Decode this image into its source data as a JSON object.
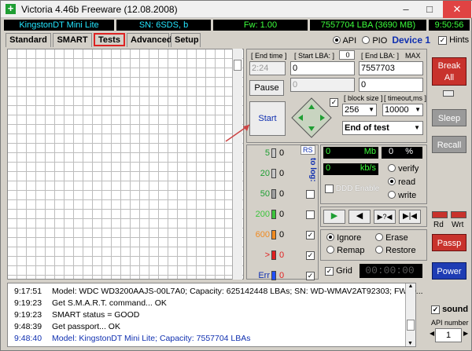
{
  "window": {
    "title": "Victoria 4.46b Freeware (12.08.2008)"
  },
  "status": {
    "drive": "KingstonDT Mini Lite",
    "sn": "SN: 6SDS",
    "sn_suffix": ", b",
    "fw": "Fw: 1.00",
    "lba": "7557704 LBA (3690 MB)",
    "time": "9:50:56"
  },
  "tabs": [
    "Standard",
    "SMART",
    "Tests",
    "Advanced",
    "Setup"
  ],
  "mode": {
    "api": "API",
    "pio": "PIO",
    "device": "Device 1",
    "hints": "Hints"
  },
  "tests": {
    "end_time_label": "[ End time ]",
    "end_time": "2:24",
    "start_lba_label": "[ Start LBA: ]",
    "start_lba_counter": "0",
    "start_lba": "0",
    "start_lba2": "0",
    "end_lba_label": "[ End LBA: ]",
    "end_lba_max": "MAX",
    "end_lba": "7557703",
    "end_lba2": "0",
    "pause": "Pause",
    "start": "Start",
    "block_size_label": "[ block size ]",
    "block_size": "256",
    "timeout_label": "[ timeout,ms ]",
    "timeout": "10000",
    "end_of_test": "End of test",
    "rs": "RS",
    "to_log": "to log:",
    "counts": [
      {
        "label": "5",
        "value": "0",
        "color": "#c8c8c8"
      },
      {
        "label": "20",
        "value": "0",
        "color": "#c8c8c8"
      },
      {
        "label": "50",
        "value": "0",
        "color": "#a0a0a0"
      },
      {
        "label": "200",
        "value": "0",
        "color": "#3cc43c"
      },
      {
        "label": "600",
        "value": "0",
        "color": "#f08a20"
      },
      {
        "label": ">",
        "value": "0",
        "color": "#e02020"
      },
      {
        "label": "Err",
        "value": "0",
        "color": "#2050ff"
      }
    ],
    "mb_value": "0",
    "mb_unit": "Mb",
    "pct_value": "0",
    "pct_unit": "%",
    "kbs_value": "0",
    "kbs_unit": "kb/s",
    "ddd_enable": "DDD Enable",
    "verify": "verify",
    "read": "read",
    "write": "write",
    "ignore": "Ignore",
    "erase": "Erase",
    "remap": "Remap",
    "restore": "Restore",
    "grid": "Grid",
    "grid_time": "00:00:00"
  },
  "side": {
    "break": "Break All",
    "sleep": "Sleep",
    "recall": "Recall",
    "rd": "Rd",
    "wrt": "Wrt",
    "passp": "Passp",
    "power": "Power",
    "sound": "sound",
    "api_number": "API number",
    "api_number_value": "1"
  },
  "log": [
    {
      "time": "9:17:51",
      "text": "Model: WDC WD3200AAJS-00L7A0; Capacity: 625142448 LBAs; SN: WD-WMAV2AT92303; FW: 0...",
      "color": "black"
    },
    {
      "time": "9:19:23",
      "text": "Get S.M.A.R.T. command... OK",
      "color": "black"
    },
    {
      "time": "9:19:23",
      "text": "SMART status = GOOD",
      "color": "black"
    },
    {
      "time": "9:48:39",
      "text": "Get passport... OK",
      "color": "black"
    },
    {
      "time": "9:48:40",
      "text": "Model: KingstonDT Mini Lite; Capacity: 7557704 LBAs",
      "color": "blue"
    }
  ]
}
